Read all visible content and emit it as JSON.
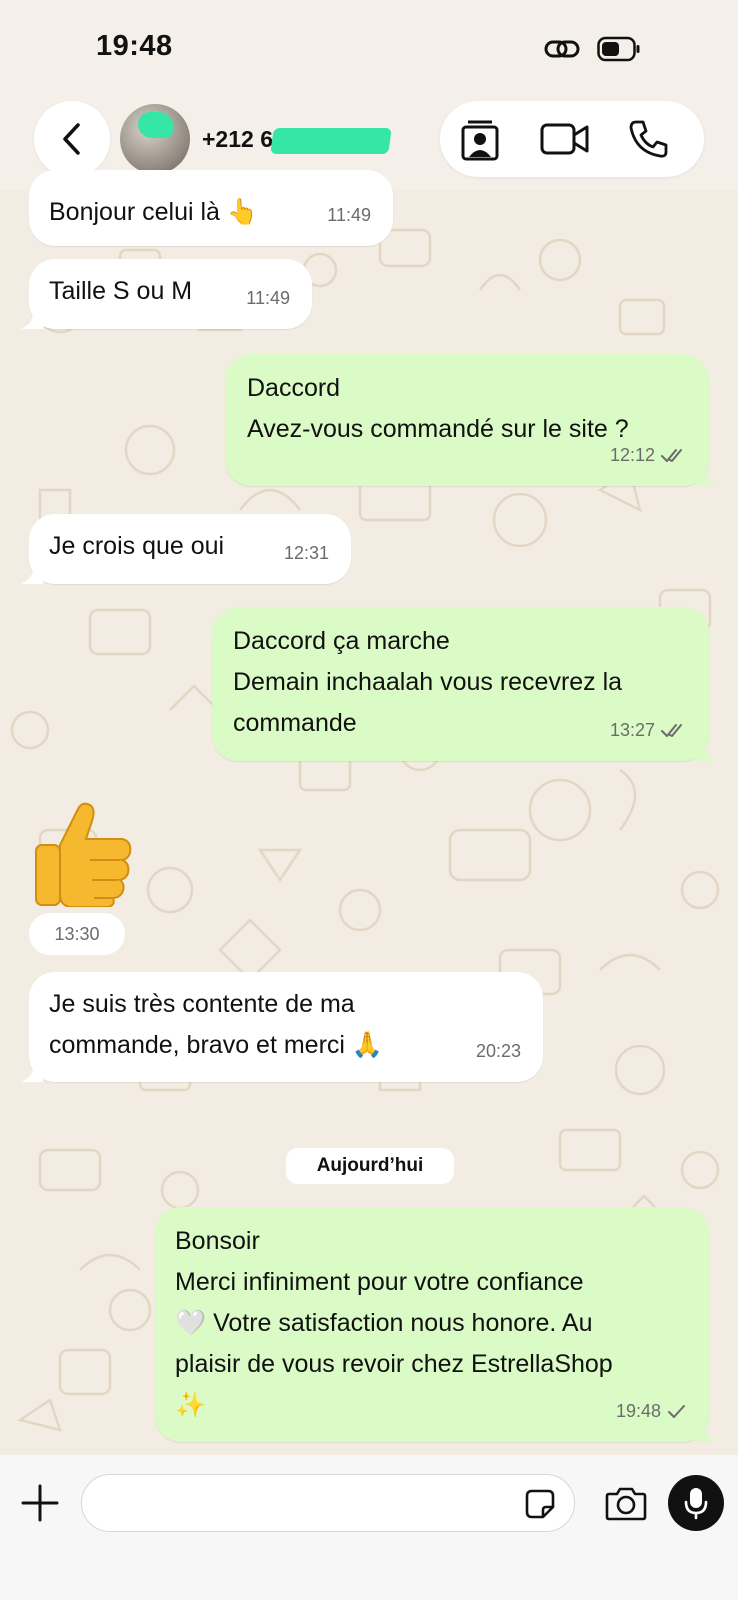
{
  "status_bar": {
    "time": "19:48"
  },
  "header": {
    "contact_name": "+212 67                 3",
    "icons": [
      "back-chevron-icon",
      "contact-card-icon",
      "video-call-icon",
      "phone-call-icon"
    ]
  },
  "messages": [
    {
      "dir": "in",
      "text": "Bonjour celui là 👆",
      "time": "11:49"
    },
    {
      "dir": "in",
      "text": "Taille S ou M",
      "time": "11:49"
    },
    {
      "dir": "out",
      "text": "Daccord\nAvez-vous commandé sur le site ?",
      "time": "12:12",
      "status": "read"
    },
    {
      "dir": "in",
      "text": "Je crois que oui",
      "time": "12:31"
    },
    {
      "dir": "out",
      "text": "Daccord ça marche\nDemain inchaalah vous recevrez la\ncommande",
      "time": "13:27",
      "status": "read"
    },
    {
      "dir": "in",
      "type": "emoji",
      "emoji": "thumbs-up",
      "time": "13:30"
    },
    {
      "dir": "in",
      "text": "Je suis très contente de ma\ncommande, bravo et merci 🙏",
      "time": "20:23"
    },
    {
      "dir": "out",
      "text": "Bonsoir\nMerci infiniment pour votre confiance\n🤍 Votre satisfaction nous honore. Au\nplaisir de vous revoir chez EstrellaShop\n✨",
      "time": "19:48",
      "status": "sent"
    }
  ],
  "date_separator": "Aujourd’hui",
  "input_bar": {
    "placeholder": "",
    "icons": [
      "plus-icon",
      "sticker-icon",
      "camera-icon",
      "microphone-icon"
    ]
  },
  "colors": {
    "incoming_bubble": "#ffffff",
    "outgoing_bubble": "#dafbc6",
    "wallpaper": "#f3ece2",
    "read_ticks": "#6b6b6b"
  }
}
